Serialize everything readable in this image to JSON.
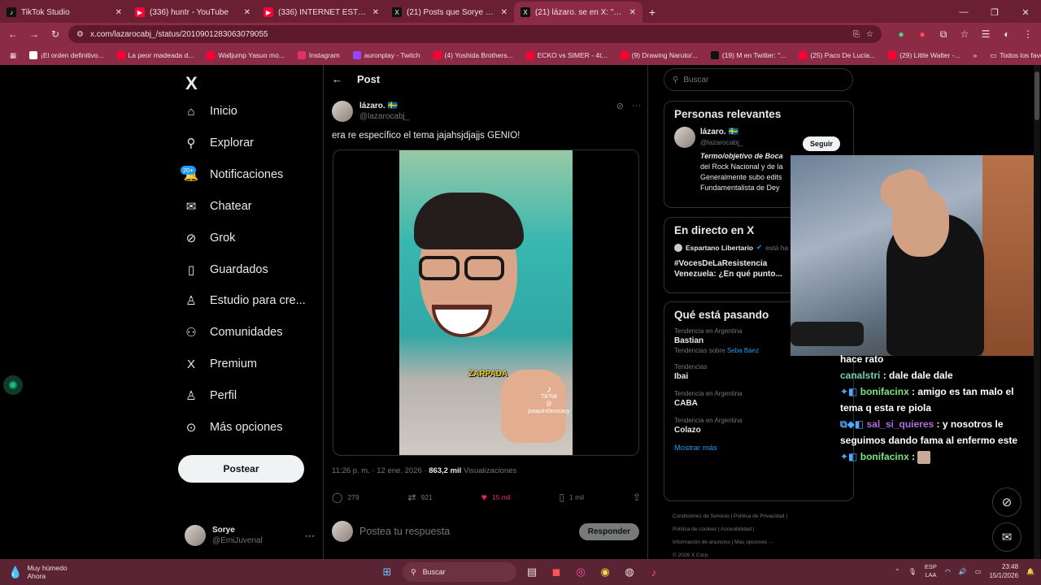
{
  "browser": {
    "tabs": [
      {
        "title": "TikTok Studio",
        "icon": "tiktok-icon",
        "color": "#111111"
      },
      {
        "title": "(336) huntr - YouTube",
        "icon": "youtube-icon",
        "color": "#ff0033"
      },
      {
        "title": "(336) INTERNET ESTÁ PODRIDO",
        "icon": "youtube-icon",
        "color": "#ff0033"
      },
      {
        "title": "(21) Posts que Sorye (@EmiJuve",
        "icon": "x-icon",
        "color": "#111111"
      },
      {
        "title": "(21) lázaro. se en X: \"era re",
        "icon": "x-icon",
        "color": "#111111",
        "active": true
      }
    ],
    "new_tab": "+",
    "url": "x.com/lazarocabj_/status/2010901283063079055",
    "bookmarks": [
      {
        "label": "¡El orden definitivo...",
        "color": "#ffffff"
      },
      {
        "label": "La peor madeada d...",
        "color": "#ff0033"
      },
      {
        "label": "Walljump Yasuo mo...",
        "color": "#ff0033"
      },
      {
        "label": "Instagram",
        "color": "#e1306c"
      },
      {
        "label": "auronplay - Twitch",
        "color": "#9146ff"
      },
      {
        "label": "(4) Yoshida Brothers...",
        "color": "#ff0033"
      },
      {
        "label": "ECKO vs SIMER - 4t...",
        "color": "#ff0033"
      },
      {
        "label": "(9) Drawing Naruto/...",
        "color": "#ff0033"
      },
      {
        "label": "(19) M en Twitter: \"...",
        "color": "#111111"
      },
      {
        "label": "(25) Paco De Lucia...",
        "color": "#ff0033"
      },
      {
        "label": "(29) Little Walter -...",
        "color": "#ff0033"
      }
    ],
    "bookmarks_more": "»",
    "all_favorites": "Todos los favoritos"
  },
  "x_nav": {
    "logo": "X",
    "badge": "20+",
    "items": [
      {
        "label": "Inicio",
        "icon": "home-icon",
        "glyph": "⌂"
      },
      {
        "label": "Explorar",
        "icon": "search-icon",
        "glyph": "⚲"
      },
      {
        "label": "Notificaciones",
        "icon": "bell-icon",
        "glyph": "🔔"
      },
      {
        "label": "Chatear",
        "icon": "mail-icon",
        "glyph": "✉"
      },
      {
        "label": "Grok",
        "icon": "grok-icon",
        "glyph": "⊘"
      },
      {
        "label": "Guardados",
        "icon": "bookmark-icon",
        "glyph": "▯"
      },
      {
        "label": "Estudio para cre...",
        "icon": "studio-icon",
        "glyph": "♙"
      },
      {
        "label": "Comunidades",
        "icon": "communities-icon",
        "glyph": "⚇"
      },
      {
        "label": "Premium",
        "icon": "x-premium-icon",
        "glyph": "X"
      },
      {
        "label": "Perfil",
        "icon": "profile-icon",
        "glyph": "♙"
      },
      {
        "label": "Más opciones",
        "icon": "more-icon",
        "glyph": "⊙"
      }
    ],
    "post_button": "Postear",
    "account": {
      "name": "Sorye",
      "handle": "@EmiJuvenal",
      "more": "···"
    }
  },
  "post": {
    "header": "Post",
    "author_name": "lázaro. 🇸🇪",
    "author_handle": "@lazarocabj_",
    "text": "era re específico el tema jajahsjdjajjs GENIO!",
    "video_caption": "ZARPADA",
    "video_watermark": "TikTok",
    "video_handle": "@ joaquindarosauy",
    "time": "11:26 p. m. · 12 ene. 2026 · ",
    "views": "863,2 mil",
    "views_label": " Visualizaciones",
    "stats": {
      "replies": "279",
      "reposts": "921",
      "likes": "15 mil",
      "bookmarks": "1 mil"
    },
    "reply_placeholder": "Postea tu respuesta",
    "reply_button": "Responder"
  },
  "sidebar": {
    "search_placeholder": "Buscar",
    "relevant_title": "Personas relevantes",
    "relevant": {
      "name": "lázaro. 🇸🇪",
      "handle": "@lazarocabj_",
      "follow": "Seguir",
      "bio": [
        "Termo/objetivo de Boca",
        "del Rock Nacional y de la",
        "Generalmente subo edits",
        "Fundamentalista de Dey"
      ]
    },
    "live_title": "En directo en X",
    "live": {
      "host": "Espartano Libertario",
      "suffix": "está ha",
      "line1": "#VocesDeLaResistencia",
      "line2": "Venezuela:  ¿En qué punto..."
    },
    "happening_title": "Qué está pasando",
    "trends": [
      {
        "category": "Tendencia en Argentina",
        "name": "Bastian",
        "sub": "Tendencias sobre ",
        "sub_link": "Seba Báez"
      },
      {
        "category": "Tendencias",
        "name": "Ibai",
        "sub": "",
        "sub_link": ""
      },
      {
        "category": "Tendencia en Argentina",
        "name": "CABA",
        "sub": "",
        "sub_link": ""
      },
      {
        "category": "Tendencia en Argentina",
        "name": "Colazo",
        "sub": "",
        "sub_link": ""
      }
    ],
    "show_more": "Mostrar más",
    "footer": [
      "Condiciones de Servicio  |  Política de Privacidad  |",
      "Política de cookies  |  Accesibilidad  |",
      "Información de anuncios  |  Más opciones ···",
      "© 2026 X Corp."
    ]
  },
  "stream_chat": [
    {
      "user": "",
      "text": "hace rato",
      "cls": ""
    },
    {
      "user": "canalstri",
      "text": " : dale dale dale",
      "cls": "u1",
      "prefix": ""
    },
    {
      "user": "bonifacinx",
      "text": " : amigo es tan malo el tema q esta re piola",
      "cls": "u2",
      "prefix": "✦◧ "
    },
    {
      "user": "sal_si_quieres",
      "text": " : y nosotros le seguimos dando fama al enfermo este",
      "cls": "u3",
      "prefix": "⧉◆◧ "
    },
    {
      "user": "bonifacinx",
      "text": " : ",
      "cls": "u2",
      "prefix": "✦◧ "
    }
  ],
  "taskbar": {
    "weather_title": "Muy húmedo",
    "weather_sub": "Ahora",
    "search": "Buscar",
    "lang1": "ESP",
    "lang2": "LAA",
    "time": "23:48",
    "date": "15/1/2026"
  }
}
